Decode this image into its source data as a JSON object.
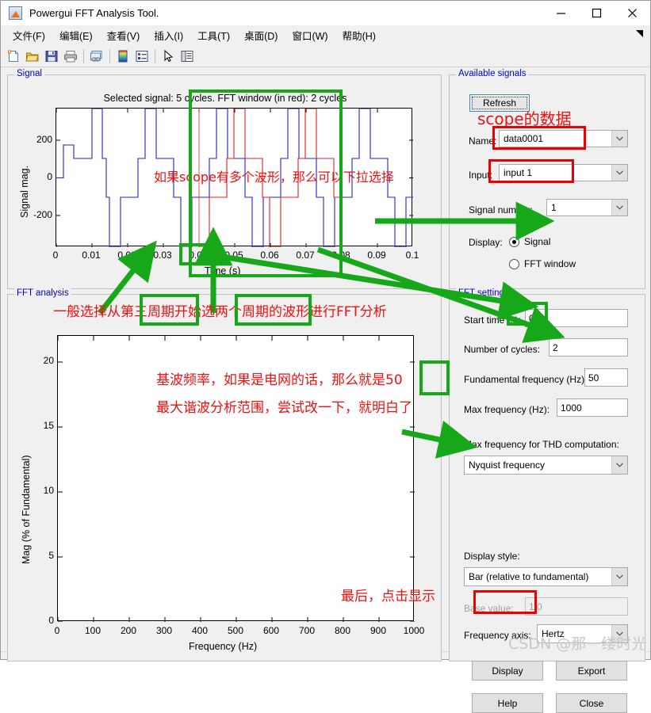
{
  "window": {
    "title": "Powergui FFT Analysis Tool.",
    "app_icon": "matlab-figure-icon",
    "minimize": "minimize-icon",
    "maximize": "maximize-icon",
    "close": "close-icon"
  },
  "menubar": {
    "items": [
      {
        "label": "文件(F)"
      },
      {
        "label": "编辑(E)"
      },
      {
        "label": "查看(V)"
      },
      {
        "label": "插入(I)"
      },
      {
        "label": "工具(T)"
      },
      {
        "label": "桌面(D)"
      },
      {
        "label": "窗口(W)"
      },
      {
        "label": "帮助(H)"
      }
    ]
  },
  "toolbar": {
    "items": [
      {
        "name": "new-figure-icon"
      },
      {
        "name": "open-folder-icon"
      },
      {
        "name": "save-icon"
      },
      {
        "name": "print-icon"
      },
      {
        "name": "link-plot-icon"
      },
      {
        "name": "colorbar-icon"
      },
      {
        "name": "legend-icon"
      },
      {
        "name": "pointer-icon"
      },
      {
        "name": "plot-browser-icon"
      }
    ]
  },
  "signal_panel": {
    "title": "Signal",
    "chart_data": {
      "type": "line",
      "title": "Selected signal: 5 cycles. FFT window (in red): 2 cycles",
      "xlabel": "Time (s)",
      "ylabel": "Signal mag.",
      "xlim": [
        0,
        0.1
      ],
      "ylim": [
        -330,
        330
      ],
      "xticks": [
        "0",
        "0.01",
        "0.02",
        "0.03",
        "0.04",
        "0.05",
        "0.06",
        "0.07",
        "0.08",
        "0.09",
        "0.1"
      ],
      "yticks": [
        "200",
        "0",
        "-200"
      ],
      "series": [
        {
          "name": "selected signal",
          "color": "#2222cc",
          "note": "5 cycles stepped PWM multilevel waveform"
        },
        {
          "name": "FFT window",
          "color": "#e02020",
          "note": "2 cycles highlighted in red from 0.04 s to 0.08 s"
        }
      ],
      "step_levels": [
        0,
        260,
        175,
        -175,
        -310,
        -175,
        175,
        310,
        175,
        -175
      ],
      "cycles": 5,
      "fft_window_cycles": 2
    }
  },
  "available_signals": {
    "title": "Available signals",
    "refresh_button": "Refresh",
    "name_label": "Name:",
    "name_value": "data0001",
    "input_label": "Input:",
    "input_value": "input 1",
    "signal_number_label": "Signal number:",
    "signal_number_value": "1",
    "display_label": "Display:",
    "radio_signal": "Signal",
    "radio_fft_window": "FFT window",
    "selected_display": "Signal"
  },
  "fft_analysis_panel": {
    "title": "FFT analysis",
    "chart_data": {
      "type": "bar",
      "title": "",
      "xlabel": "Frequency (Hz)",
      "ylabel": "Mag (% of Fundamental)",
      "xlim": [
        0,
        1000
      ],
      "ylim": [
        0,
        22
      ],
      "xticks": [
        "0",
        "100",
        "200",
        "300",
        "400",
        "500",
        "600",
        "700",
        "800",
        "900",
        "1000"
      ],
      "yticks": [
        "0",
        "5",
        "10",
        "15",
        "20"
      ],
      "categories": [],
      "values": [],
      "note": "empty plot - results not yet computed"
    }
  },
  "fft_settings": {
    "title": "FFT settings",
    "start_time_label": "Start time (s):",
    "start_time_value": "0.04",
    "number_of_cycles_label": "Number of cycles:",
    "number_of_cycles_value": "2",
    "fundamental_frequency_label": "Fundamental frequency (Hz):",
    "fundamental_frequency_value": "50",
    "max_frequency_label": "Max frequency (Hz):",
    "max_frequency_value": "1000",
    "max_freq_thd_label": "Max frequency for THD computation:",
    "max_freq_thd_value": "Nyquist frequency",
    "display_style_label": "Display style:",
    "display_style_value": "Bar (relative to fundamental)",
    "base_value_label": "Base value:",
    "base_value_value": "1.0",
    "frequency_axis_label": "Frequency axis:",
    "frequency_axis_value": "Hertz",
    "display_button": "Display",
    "export_button": "Export",
    "help_button": "Help",
    "close_button": "Close"
  },
  "annotations": {
    "colors": {
      "red": "#f01010",
      "green": "#17a81a",
      "red_box": "#ee0000"
    },
    "texts": [
      {
        "id": "scope-data",
        "text": "scope的数据"
      },
      {
        "id": "multi-waveform",
        "text": "如果scope有多个波形，那么可以下拉选择"
      },
      {
        "id": "cycle-choice",
        "text": "一般选择从第三周期开始选两个周期的波形进行FFT分析"
      },
      {
        "id": "fundamental-note",
        "text": "基波频率，如果是电网的话，那么就是50"
      },
      {
        "id": "max-harmonic-note",
        "text": "最大谐波分析范围，尝试改一下，就明白了"
      },
      {
        "id": "click-display",
        "text": "最后，点击显示"
      }
    ]
  },
  "watermark": {
    "text": "CSDN @那一缕时光"
  }
}
